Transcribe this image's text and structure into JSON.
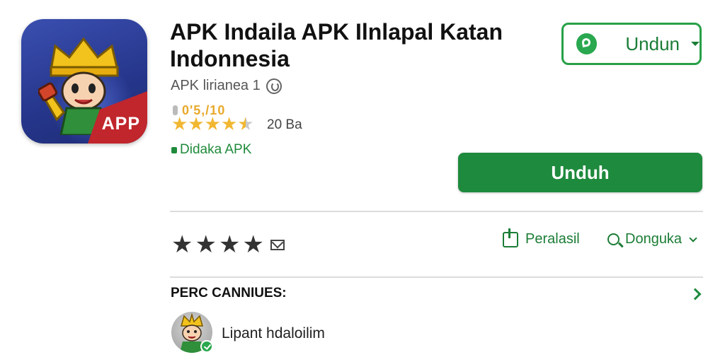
{
  "app": {
    "icon_badge": "APP",
    "title": "APK Indaila APK Ilnlapal Katan Indonnesia",
    "developer": "APK lirianea 1",
    "rating_value": "0'5,/10",
    "rating_count": "20 Ba",
    "verified_label": "Didaka APK"
  },
  "buttons": {
    "download_dropdown": "Undun",
    "download": "Unduh"
  },
  "actions": {
    "share_label": "Peralasil",
    "search_label": "Donguka"
  },
  "rate": {
    "stars": 4
  },
  "section": {
    "title": "PERC CANNIUES:",
    "reviewer": "Lipant hdaloilim"
  },
  "colors": {
    "accent_green": "#1e8a3d",
    "star_gold": "#f1b731",
    "icon_blue": "#25358a",
    "badge_red": "#c0262c"
  },
  "icons": [
    "dev-badge-icon",
    "star-icon",
    "lock-icon",
    "whatsapp-icon",
    "caret-down-icon",
    "mail-icon",
    "share-icon",
    "search-icon",
    "chevron-right-icon",
    "verified-check-icon"
  ]
}
